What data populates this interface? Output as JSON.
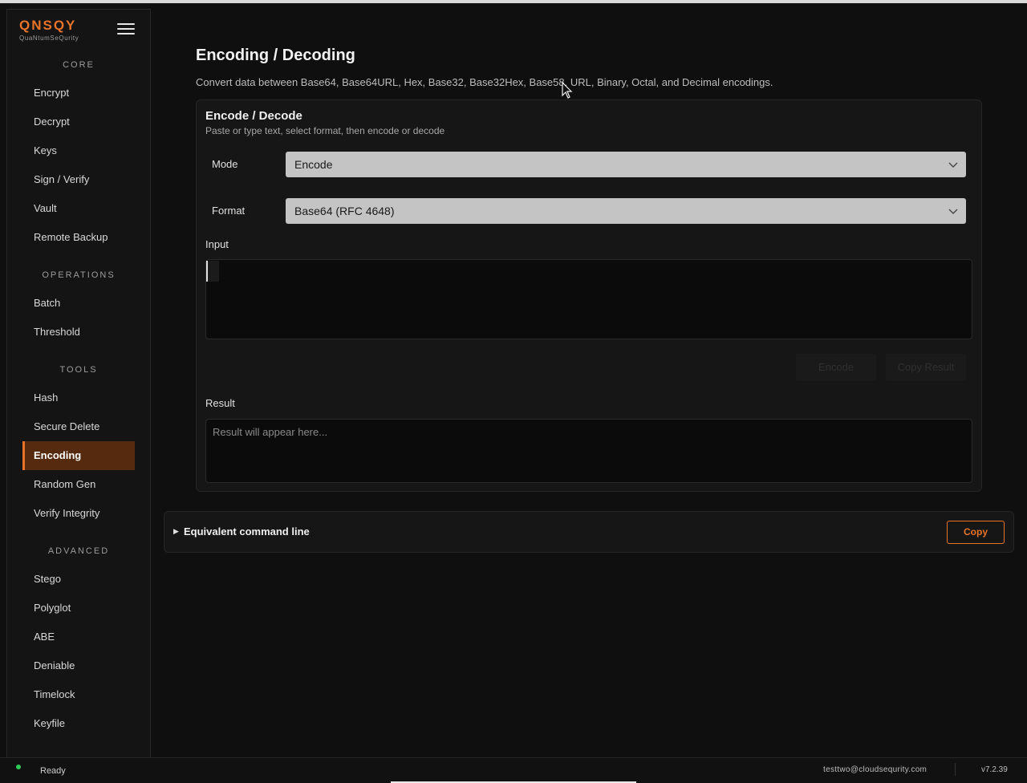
{
  "brand": {
    "name": "QNSQY",
    "subtitle": "QuaNtumSeQurity"
  },
  "sidebar": {
    "sections": [
      {
        "title": "CORE",
        "items": [
          "Encrypt",
          "Decrypt",
          "Keys",
          "Sign / Verify",
          "Vault",
          "Remote Backup"
        ]
      },
      {
        "title": "OPERATIONS",
        "items": [
          "Batch",
          "Threshold"
        ]
      },
      {
        "title": "TOOLS",
        "items": [
          "Hash",
          "Secure Delete",
          "Encoding",
          "Random Gen",
          "Verify Integrity"
        ]
      },
      {
        "title": "ADVANCED",
        "items": [
          "Stego",
          "Polyglot",
          "ABE",
          "Deniable",
          "Timelock",
          "Keyfile"
        ]
      }
    ],
    "active": "Encoding"
  },
  "page": {
    "title": "Encoding / Decoding",
    "description": "Convert data between Base64, Base64URL, Hex, Base32, Base32Hex, Base58, URL, Binary, Octal, and Decimal encodings."
  },
  "card": {
    "title": "Encode / Decode",
    "subtitle": "Paste or type text, select format, then encode or decode",
    "mode_label": "Mode",
    "mode_value": "Encode",
    "format_label": "Format",
    "format_value": "Base64 (RFC 4648)",
    "input_label": "Input",
    "input_value": "",
    "encode_button": "Encode",
    "copy_result_button": "Copy Result",
    "result_label": "Result",
    "result_placeholder": "Result will appear here..."
  },
  "command_line": {
    "label": "Equivalent command line",
    "copy_button": "Copy"
  },
  "status": {
    "text": "Ready",
    "user": "testtwo@cloudsequrity.com",
    "version": "v7.2.39"
  },
  "colors": {
    "accent": "#e8742a",
    "active_bg": "#552a0e",
    "status_ok": "#2ecc57"
  }
}
